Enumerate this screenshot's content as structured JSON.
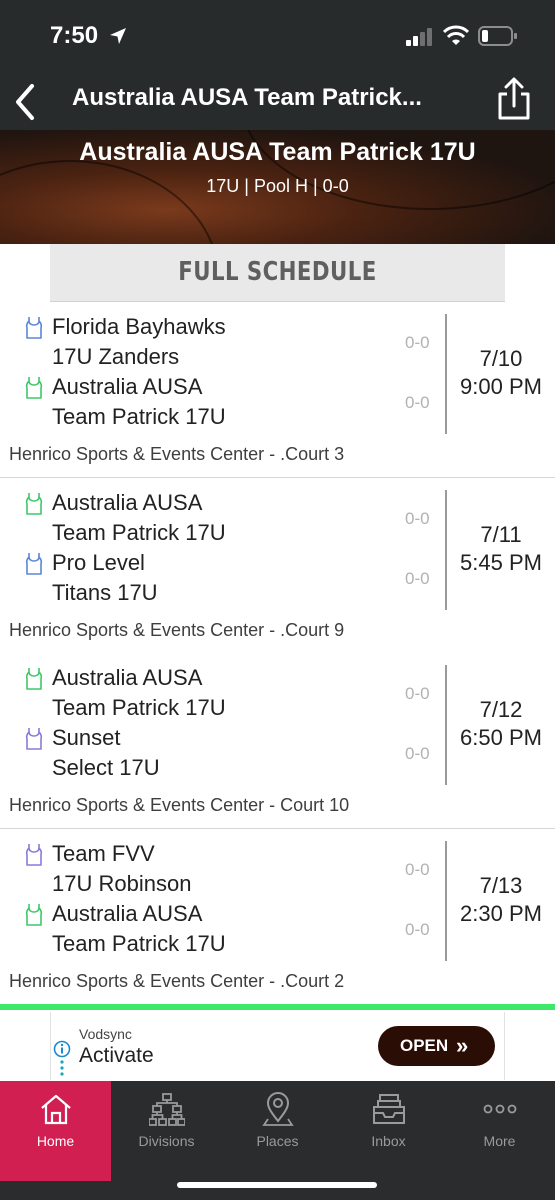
{
  "status_bar": {
    "time": "7:50"
  },
  "nav": {
    "title": "Australia AUSA Team Patrick..."
  },
  "team_banner": {
    "name": "Australia AUSA Team Patrick 17U",
    "meta": "17U | Pool H | 0-0"
  },
  "schedule_header": "FULL SCHEDULE",
  "colors": {
    "home_jersey": "#3ec86a",
    "away_jersey": "#5b86d8",
    "divider_green": "#3ee86a",
    "active_tab": "#d11f52"
  },
  "games": [
    {
      "team1": [
        "Florida Bayhawks",
        "17U Zanders"
      ],
      "team1_jersey": "away",
      "score1": "0-0",
      "team2": [
        "Australia AUSA",
        "Team Patrick 17U"
      ],
      "team2_jersey": "home",
      "score2": "0-0",
      "date": "7/10",
      "time": "9:00 PM",
      "venue": "Henrico Sports & Events Center - .Court 3"
    },
    {
      "team1": [
        "Australia AUSA",
        "Team Patrick 17U"
      ],
      "team1_jersey": "home",
      "score1": "0-0",
      "team2": [
        "Pro Level",
        "Titans 17U"
      ],
      "team2_jersey": "away",
      "score2": "0-0",
      "date": "7/11",
      "time": "5:45 PM",
      "venue": "Henrico Sports & Events Center - .Court 9"
    },
    {
      "team1": [
        "Australia AUSA",
        "Team Patrick 17U"
      ],
      "team1_jersey": "home",
      "score1": "0-0",
      "team2": [
        "Sunset",
        "Select 17U"
      ],
      "team2_jersey": "purple",
      "score2": "0-0",
      "date": "7/12",
      "time": "6:50 PM",
      "venue": "Henrico Sports & Events Center - Court 10"
    },
    {
      "team1": [
        "Team FVV",
        "17U Robinson"
      ],
      "team1_jersey": "purple",
      "score1": "0-0",
      "team2": [
        "Australia AUSA",
        "Team Patrick 17U"
      ],
      "team2_jersey": "home",
      "score2": "0-0",
      "date": "7/13",
      "time": "2:30 PM",
      "venue": "Henrico Sports & Events Center - .Court 2"
    }
  ],
  "ad": {
    "advertiser": "Vodsync",
    "headline": "Activate",
    "cta": "OPEN"
  },
  "tabs": [
    {
      "label": "Home",
      "icon": "home-icon",
      "active": true
    },
    {
      "label": "Divisions",
      "icon": "bracket-icon",
      "active": false
    },
    {
      "label": "Places",
      "icon": "map-pin-icon",
      "active": false
    },
    {
      "label": "Inbox",
      "icon": "inbox-icon",
      "active": false
    },
    {
      "label": "More",
      "icon": "more-icon",
      "active": false
    }
  ]
}
